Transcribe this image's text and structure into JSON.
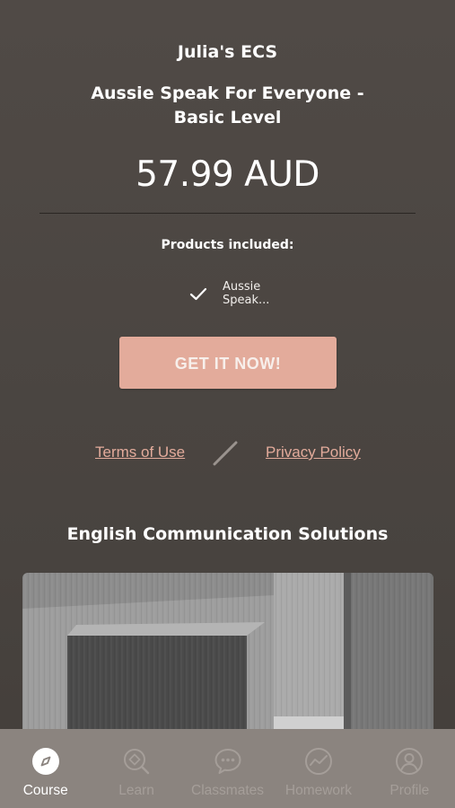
{
  "header": {
    "school_name": "Julia's ECS",
    "course_title": "Aussie Speak For Everyone - Basic Level",
    "price": "57.99 AUD"
  },
  "products": {
    "label": "Products included:",
    "items": [
      {
        "name": "Aussie Speak...",
        "icon": "checkmark-icon"
      }
    ]
  },
  "purchase": {
    "button_label": "GET IT NOW!"
  },
  "legal": {
    "terms_label": "Terms of Use",
    "privacy_label": "Privacy Policy"
  },
  "footer": {
    "company_name": "English Communication Solutions"
  },
  "colors": {
    "background": "#4a4541",
    "accent": "#e3ab9b",
    "tab_bar": "#8b847f",
    "tab_inactive": "#a59e99"
  },
  "tabs": [
    {
      "label": "Course",
      "icon": "compass-icon",
      "active": true
    },
    {
      "label": "Learn",
      "icon": "search-learn-icon",
      "active": false
    },
    {
      "label": "Classmates",
      "icon": "chat-bubble-icon",
      "active": false
    },
    {
      "label": "Homework",
      "icon": "progress-chart-icon",
      "active": false
    },
    {
      "label": "Profile",
      "icon": "profile-icon",
      "active": false
    }
  ]
}
